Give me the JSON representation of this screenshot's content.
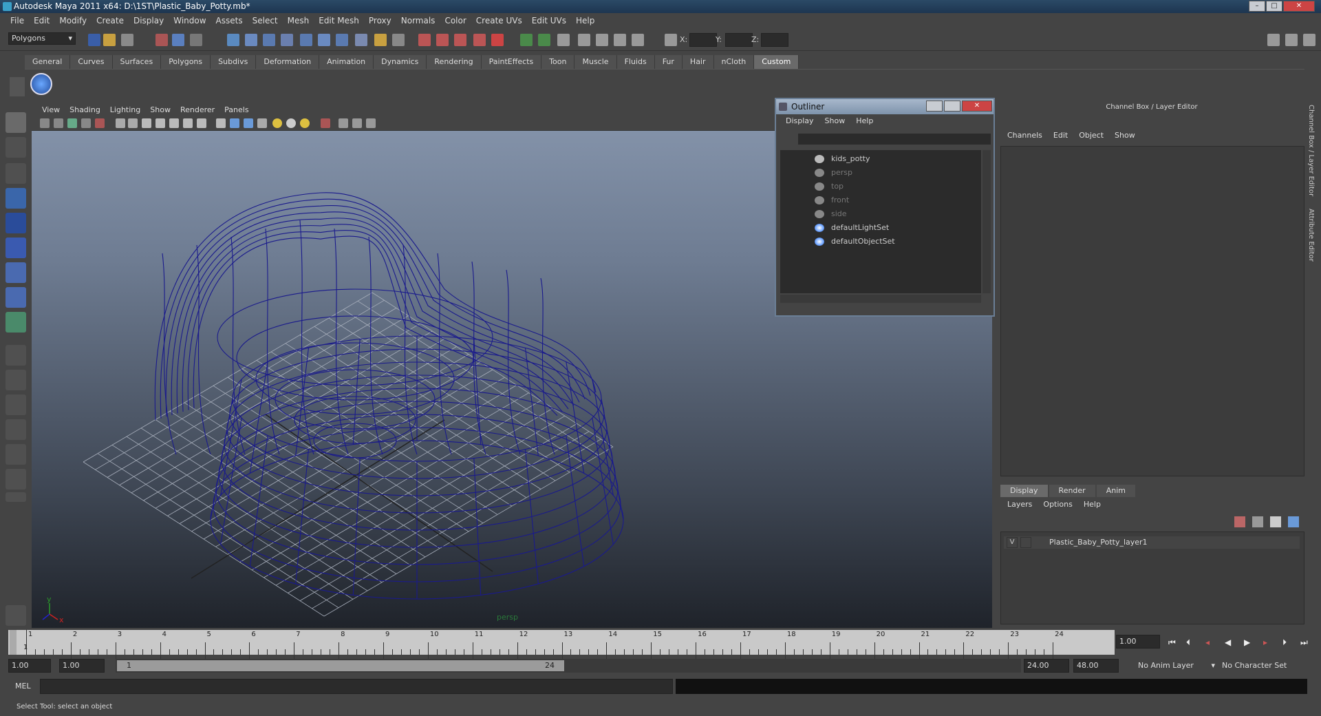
{
  "window": {
    "title": "Autodesk Maya 2011 x64: D:\\1ST\\Plastic_Baby_Potty.mb*",
    "min_label": "–",
    "max_label": "□",
    "close_label": "✕"
  },
  "menubar": [
    "File",
    "Edit",
    "Modify",
    "Create",
    "Display",
    "Window",
    "Assets",
    "Select",
    "Mesh",
    "Edit Mesh",
    "Proxy",
    "Normals",
    "Color",
    "Create UVs",
    "Edit UVs",
    "Help"
  ],
  "statusline": {
    "mode": "Polygons",
    "x_label": "X:",
    "y_label": "Y:",
    "z_label": "Z:"
  },
  "shelf": {
    "tabs": [
      "General",
      "Curves",
      "Surfaces",
      "Polygons",
      "Subdivs",
      "Deformation",
      "Animation",
      "Dynamics",
      "Rendering",
      "PaintEffects",
      "Toon",
      "Muscle",
      "Fluids",
      "Fur",
      "Hair",
      "nCloth",
      "Custom"
    ],
    "active": "Custom"
  },
  "viewport": {
    "menu": [
      "View",
      "Shading",
      "Lighting",
      "Show",
      "Renderer",
      "Panels"
    ],
    "camera_label": "persp",
    "axis_y": "y",
    "axis_x": "x"
  },
  "outliner": {
    "title": "Outliner",
    "menu": [
      "Display",
      "Show",
      "Help"
    ],
    "items": [
      {
        "label": "kids_potty",
        "icon": "mesh-icon",
        "dim": false
      },
      {
        "label": "persp",
        "icon": "camera-icon",
        "dim": true
      },
      {
        "label": "top",
        "icon": "camera-icon",
        "dim": true
      },
      {
        "label": "front",
        "icon": "camera-icon",
        "dim": true
      },
      {
        "label": "side",
        "icon": "camera-icon",
        "dim": true
      },
      {
        "label": "defaultLightSet",
        "icon": "set-icon",
        "dim": false
      },
      {
        "label": "defaultObjectSet",
        "icon": "set-icon",
        "dim": false
      }
    ]
  },
  "channelbox": {
    "title": "Channel Box / Layer Editor",
    "menu": [
      "Channels",
      "Edit",
      "Object",
      "Show"
    ],
    "layer_tabs": [
      "Display",
      "Render",
      "Anim"
    ],
    "layer_tab_active": "Display",
    "layer_menu": [
      "Layers",
      "Options",
      "Help"
    ],
    "layer": {
      "visible": "V",
      "name": "Plastic_Baby_Potty_layer1"
    },
    "side_tabs": [
      "Channel Box / Layer Editor",
      "Attribute Editor"
    ]
  },
  "timeslider": {
    "ticks": [
      1,
      2,
      3,
      4,
      5,
      6,
      7,
      8,
      9,
      10,
      11,
      12,
      13,
      14,
      15,
      16,
      17,
      18,
      19,
      20,
      21,
      22,
      23,
      24
    ],
    "current_frame": "1",
    "current_frame_field": "1.00"
  },
  "range": {
    "start": "1.00",
    "playback_start": "1.00",
    "slider_start": "1",
    "slider_end": "24",
    "playback_end": "24.00",
    "end": "48.00",
    "anim_layer": "No Anim Layer",
    "character_set": "No Character Set"
  },
  "commandline": {
    "label": "MEL"
  },
  "helpline": {
    "text": "Select Tool: select an object"
  },
  "colors": {
    "wireframe": "#1a1a8c",
    "grid": "#a9b0bd",
    "active_tab": "#6a6a6a"
  }
}
